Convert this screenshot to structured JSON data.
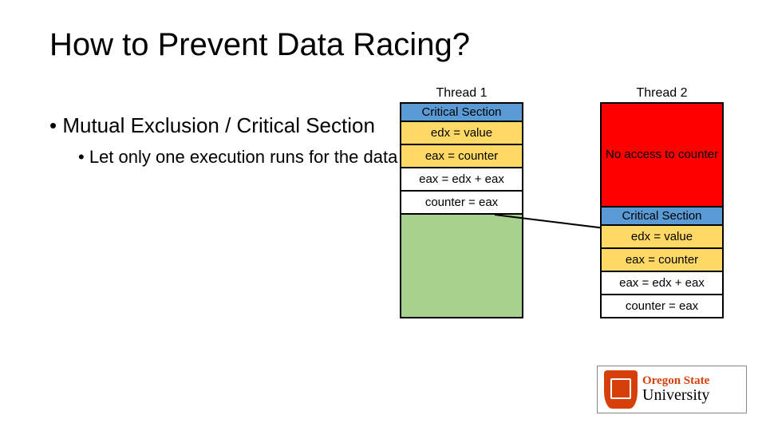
{
  "title": "How to Prevent Data Racing?",
  "bullets": {
    "main": "Mutual Exclusion / Critical Section",
    "sub": "Let only one execution runs for the data"
  },
  "thread1": {
    "header": "Thread 1",
    "critical_section_label": "Critical Section",
    "rows": [
      "edx = value",
      "eax = counter",
      "eax = edx + eax",
      "counter = eax"
    ]
  },
  "thread2": {
    "header": "Thread 2",
    "blocked_label": "No access to counter",
    "critical_section_label": "Critical Section",
    "rows": [
      "edx = value",
      "eax = counter",
      "eax = edx + eax",
      "counter = eax"
    ]
  },
  "logo": {
    "line1": "Oregon State",
    "line2": "University"
  }
}
